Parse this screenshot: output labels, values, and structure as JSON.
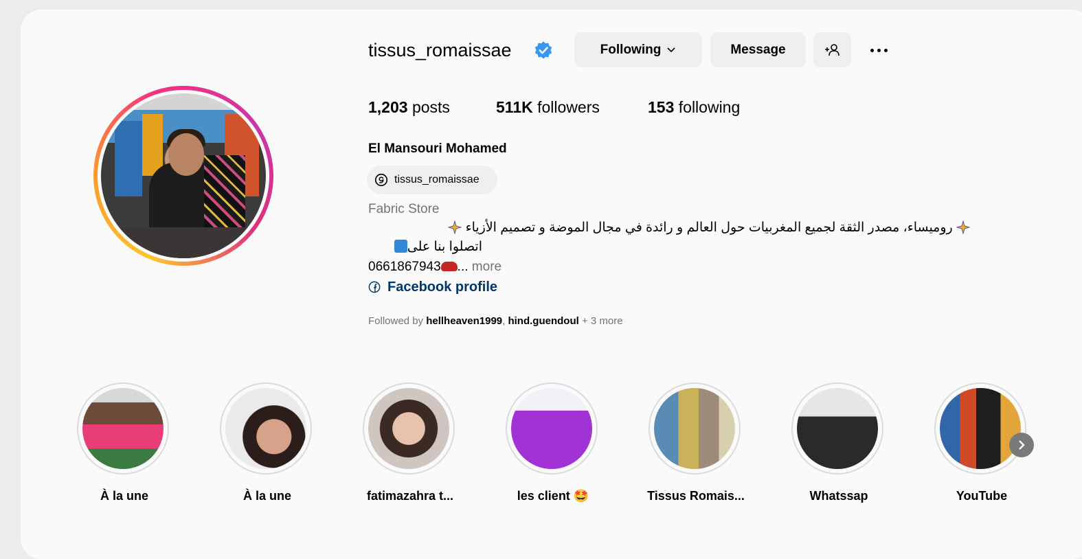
{
  "profile": {
    "username": "tissus_romaissae",
    "verified_icon": "verified-badge-icon",
    "buttons": {
      "following": "Following",
      "message": "Message"
    },
    "stats": {
      "posts_count": "1,203",
      "posts_label": "posts",
      "followers_count": "511K",
      "followers_label": "followers",
      "following_count": "153",
      "following_label": "following"
    },
    "full_name": "El Mansouri Mohamed",
    "threads_handle": "tissus_romaissae",
    "category": "Fabric Store",
    "bio": {
      "line1": "روميساء، مصدر الثقة لجميع المغربيات حول العالم و رائدة في مجال الموضة و تصميم الأزياء",
      "line2": "اتصلوا بنا على",
      "line3_phone": "0661867943",
      "line3_more_prefix": "... ",
      "line3_more": "more"
    },
    "facebook_link": "Facebook profile",
    "followed_by": {
      "prefix": "Followed by ",
      "user1": "hellheaven1999",
      "separator": ", ",
      "user2": "hind.guendoul",
      "suffix": " + 3 more"
    }
  },
  "highlights": [
    {
      "label": "À la une"
    },
    {
      "label": "À la une"
    },
    {
      "label": "fatimazahra t..."
    },
    {
      "label": "les client 🤩"
    },
    {
      "label": "Tissus Romais..."
    },
    {
      "label": "Whatssap"
    },
    {
      "label": "YouTube"
    }
  ],
  "colors": {
    "page_bg": "#ececec",
    "card_bg": "#fafafa",
    "button_bg": "#efefef",
    "verified_blue": "#3897f0",
    "link_blue": "#00376b",
    "secondary_text": "#737373"
  }
}
